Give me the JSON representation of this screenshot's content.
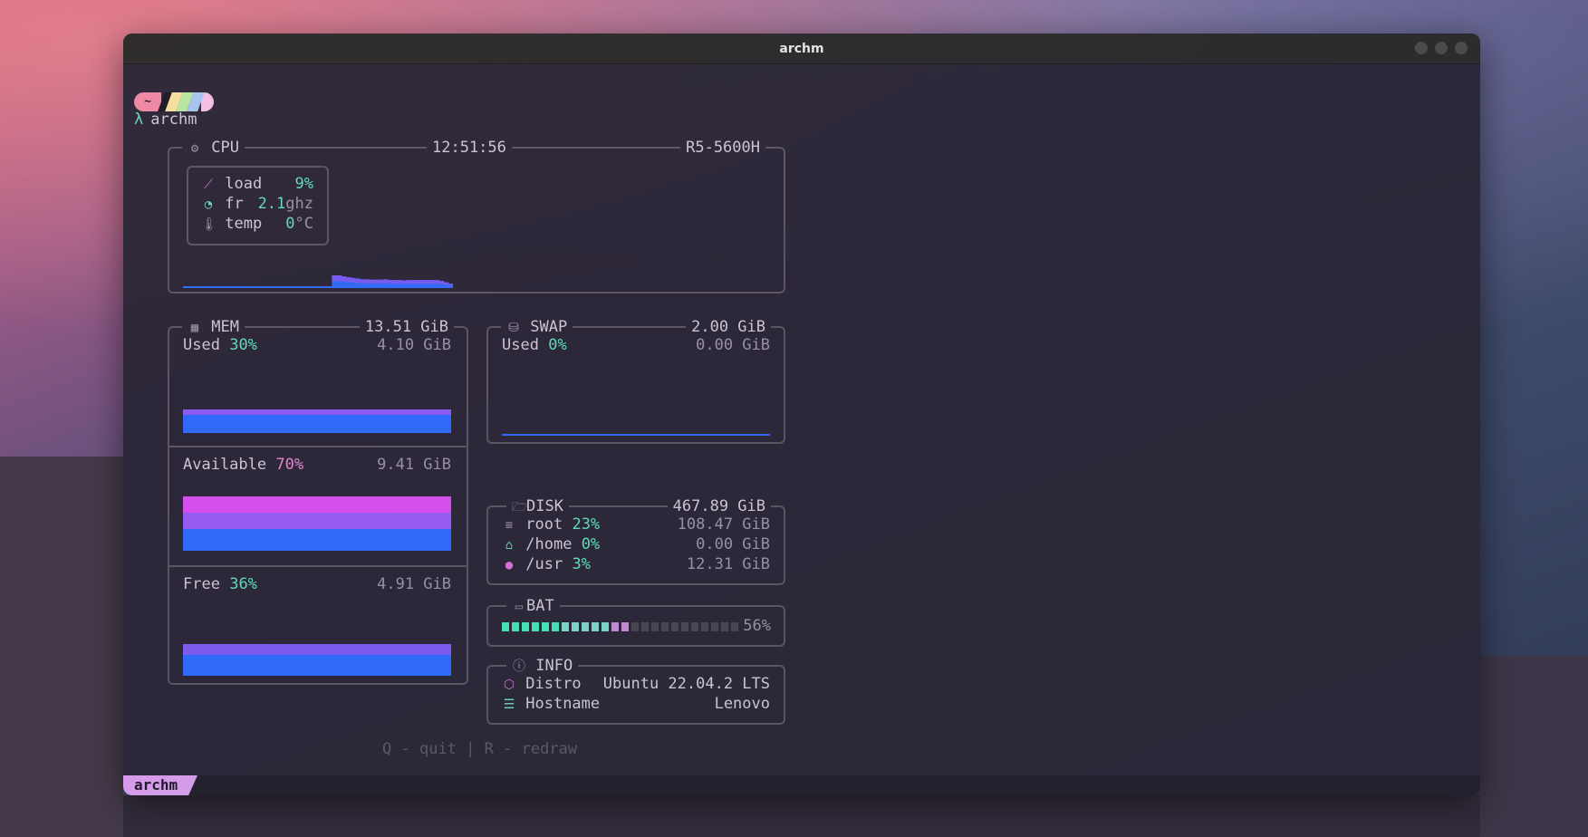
{
  "window": {
    "title": "archm"
  },
  "prompt": {
    "pill_text": "~",
    "symbol": "λ",
    "command": "archm"
  },
  "cpu": {
    "title": "CPU",
    "time": "12:51:56",
    "model": "R5-5600H",
    "load_label": "load",
    "load_value": "9%",
    "fr_label": "fr",
    "fr_value": "2.1",
    "fr_unit": "ghz",
    "temp_label": "temp",
    "temp_value": "0",
    "temp_unit": "°C",
    "history_percent": [
      0,
      0,
      0,
      0,
      0,
      0,
      0,
      0,
      0,
      0,
      0,
      0,
      0,
      0,
      0,
      0,
      0,
      0,
      0,
      0,
      0,
      0,
      0,
      0,
      0,
      0,
      0,
      0,
      0,
      0,
      0,
      0,
      35,
      35,
      32,
      30,
      28,
      26,
      24,
      24,
      23,
      23,
      23,
      24,
      22,
      22,
      22,
      21,
      22,
      22,
      22,
      22,
      22,
      22,
      22,
      20,
      16,
      12
    ]
  },
  "mem": {
    "title": "MEM",
    "total": "13.51 GiB",
    "used_label": "Used",
    "used_pct": "30%",
    "used_value": "4.10 GiB",
    "available_label": "Available",
    "available_pct": "70%",
    "available_value": "9.41 GiB",
    "free_label": "Free",
    "free_pct": "36%",
    "free_value": "4.91 GiB"
  },
  "swap": {
    "title": "SWAP",
    "total": "2.00 GiB",
    "used_label": "Used",
    "used_pct": "0%",
    "used_value": "0.00 GiB"
  },
  "disk": {
    "title": "DISK",
    "total": "467.89 GiB",
    "rows": [
      {
        "name": "root",
        "pct": "23%",
        "value": "108.47 GiB"
      },
      {
        "name": "/home",
        "pct": "0%",
        "value": "0.00 GiB"
      },
      {
        "name": "/usr",
        "pct": "3%",
        "value": "12.31 GiB"
      }
    ]
  },
  "bat": {
    "title": "BAT",
    "value": "56%",
    "level": 0.56
  },
  "info": {
    "title": "INFO",
    "distro_label": "Distro",
    "distro_value": "Ubuntu 22.04.2 LTS",
    "hostname_label": "Hostname",
    "hostname_value": "Lenovo"
  },
  "hint": {
    "q_key": "Q",
    "q_text": "- quit",
    "sep": "|",
    "r_key": "R",
    "r_text": "- redraw"
  },
  "statusbar": {
    "tag": "archm"
  },
  "colors": {
    "accent_teal": "#5fe0b8",
    "accent_pink": "#e58ad0",
    "bar_blue": "#2f6cff",
    "bar_violet": "#8b5cf6",
    "bar_magenta": "#d94ff2"
  }
}
